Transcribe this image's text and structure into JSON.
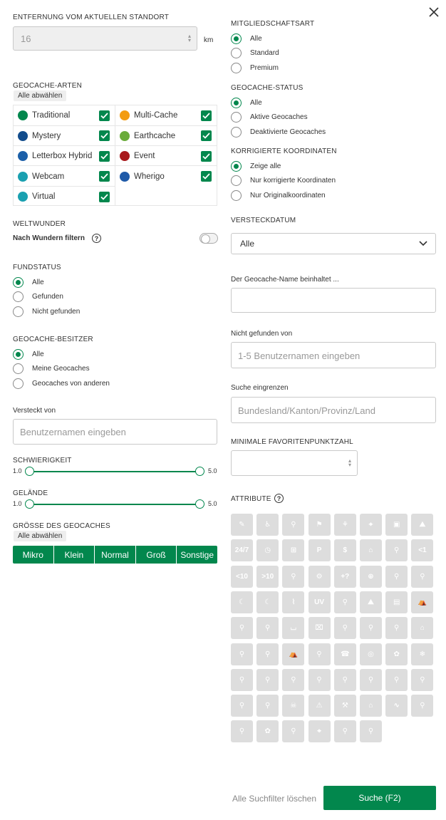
{
  "distance": {
    "header": "ENTFERNUNG VOM AKTUELLEN STANDORT",
    "value": "16",
    "unit": "km"
  },
  "cache_types": {
    "header": "GEOCACHE-ARTEN",
    "deselect_all": "Alle abwählen",
    "items": [
      {
        "label": "Traditional",
        "color": "#02874d",
        "icon": "traditional-icon",
        "checked": true
      },
      {
        "label": "Multi-Cache",
        "color": "#f39c12",
        "icon": "multi-cache-icon",
        "checked": true
      },
      {
        "label": "Mystery",
        "color": "#124c8c",
        "icon": "mystery-icon",
        "checked": true
      },
      {
        "label": "Earthcache",
        "color": "#6aab3b",
        "icon": "earthcache-icon",
        "checked": true
      },
      {
        "label": "Letterbox Hybrid",
        "color": "#1b5fa8",
        "icon": "letterbox-icon",
        "checked": true
      },
      {
        "label": "Event",
        "color": "#a8191c",
        "icon": "event-icon",
        "checked": true
      },
      {
        "label": "Webcam",
        "color": "#1aa0b0",
        "icon": "webcam-icon",
        "checked": true
      },
      {
        "label": "Wherigo",
        "color": "#1f5aa8",
        "icon": "wherigo-icon",
        "checked": true
      },
      {
        "label": "Virtual",
        "color": "#1aa0b0",
        "icon": "virtual-icon",
        "checked": true
      }
    ]
  },
  "wonders": {
    "header": "WELTWUNDER",
    "label": "Nach Wundern filtern",
    "help": "?"
  },
  "found_status": {
    "header": "FUNDSTATUS",
    "options": [
      "Alle",
      "Gefunden",
      "Nicht gefunden"
    ],
    "selected": 0
  },
  "owner": {
    "header": "GEOCACHE-BESITZER",
    "options": [
      "Alle",
      "Meine Geocaches",
      "Geocaches von anderen"
    ],
    "selected": 0
  },
  "hidden_by": {
    "label": "Versteckt von",
    "placeholder": "Benutzernamen eingeben"
  },
  "difficulty": {
    "header": "SCHWIERIGKEIT",
    "min": "1.0",
    "max": "5.0"
  },
  "terrain": {
    "header": "GELÄNDE",
    "min": "1.0",
    "max": "5.0"
  },
  "size": {
    "header": "GRÖSSE DES GEOCACHES",
    "deselect_all": "Alle abwählen",
    "options": [
      "Mikro",
      "Klein",
      "Normal",
      "Groß",
      "Sonstige"
    ]
  },
  "membership": {
    "header": "MITGLIEDSCHAFTSART",
    "options": [
      "Alle",
      "Standard",
      "Premium"
    ],
    "selected": 0
  },
  "status": {
    "header": "GEOCACHE-STATUS",
    "options": [
      "Alle",
      "Aktive Geocaches",
      "Deaktivierte Geocaches"
    ],
    "selected": 0
  },
  "corrected": {
    "header": "KORRIGIERTE KOORDINATEN",
    "options": [
      "Zeige alle",
      "Nur korrigierte Koordinaten",
      "Nur Originalkoordinaten"
    ],
    "selected": 0
  },
  "hide_date": {
    "header": "VERSTECKDATUM",
    "value": "Alle"
  },
  "name_contains": {
    "label": "Der Geocache-Name beinhaltet ..."
  },
  "not_found_by": {
    "label": "Nicht gefunden von",
    "placeholder": "1-5 Benutzernamen eingeben"
  },
  "narrow": {
    "label": "Suche eingrenzen",
    "placeholder": "Bundesland/Kanton/Provinz/Land"
  },
  "min_favs": {
    "header": "MINIMALE FAVORITENPUNKTZAHL"
  },
  "attributes": {
    "header": "ATTRIBUTE",
    "help": "?"
  },
  "actions": {
    "clear": "Alle Suchfilter löschen",
    "search": "Suche (F2)"
  }
}
